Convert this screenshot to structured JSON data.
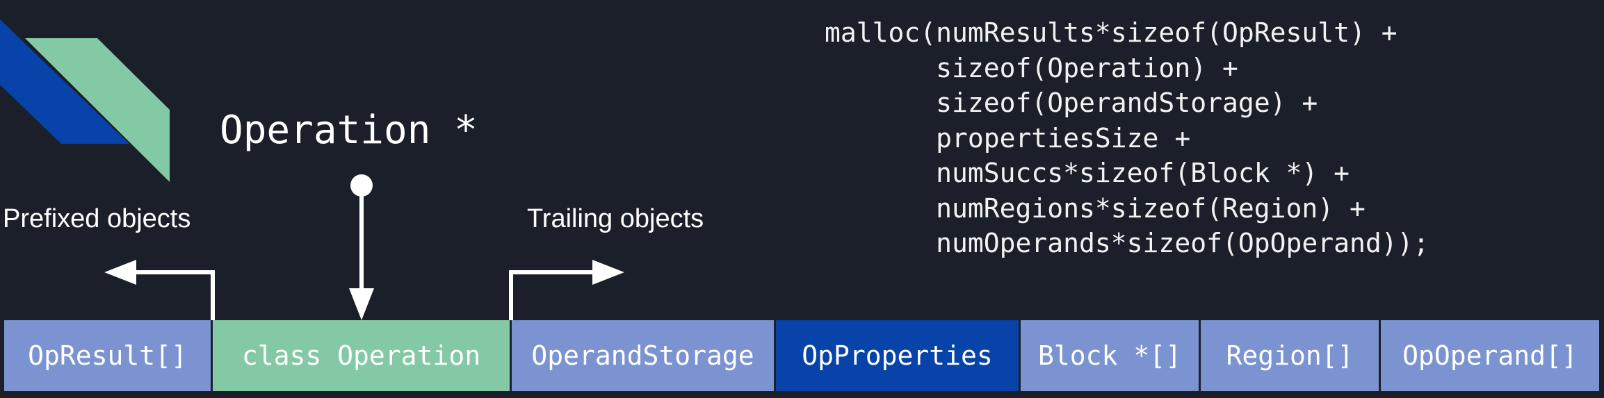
{
  "colors": {
    "background": "#1b1f2a",
    "block_light": "#7b93d1",
    "block_green": "#84c9a6",
    "block_dark": "#0743a8",
    "logo_blue": "#0743a8",
    "logo_green": "#84c9a6",
    "arrow": "#ffffff"
  },
  "code": {
    "lines": [
      "malloc(numResults*sizeof(OpResult) +",
      "       sizeof(Operation) +",
      "       sizeof(OperandStorage) +",
      "       propertiesSize +",
      "       numSuccs*sizeof(Block *) +",
      "       numRegions*sizeof(Region) +",
      "       numOperands*sizeof(OpOperand));"
    ]
  },
  "pointer_label": "Operation *",
  "prefix_label": "Prefixed objects",
  "trailing_label": "Trailing objects",
  "memory_blocks": [
    {
      "label": "OpResult[]",
      "color": "#7b93d1"
    },
    {
      "label": "class Operation",
      "color": "#84c9a6"
    },
    {
      "label": "OperandStorage",
      "color": "#7b93d1"
    },
    {
      "label": "OpProperties",
      "color": "#0743a8"
    },
    {
      "label": "Block *[]",
      "color": "#7b93d1"
    },
    {
      "label": "Region[]",
      "color": "#7b93d1"
    },
    {
      "label": "OpOperand[]",
      "color": "#7b93d1"
    }
  ]
}
